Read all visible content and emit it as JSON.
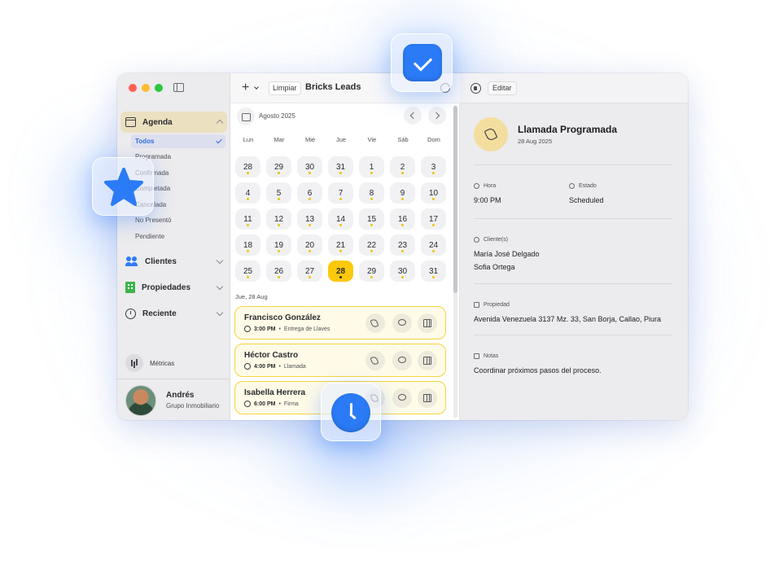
{
  "sidebar": {
    "agenda_label": "Agenda",
    "filters": [
      "Todos",
      "Programada",
      "Confirmada",
      "Completada",
      "Cancelada",
      "No Presentó",
      "Pendiente"
    ],
    "clientes_label": "Clientes",
    "propiedades_label": "Propiedades",
    "reciente_label": "Reciente",
    "metricas_label": "Métricas",
    "user": {
      "name": "Andrés",
      "org": "Grupo Inmobiliario"
    }
  },
  "toolbar": {
    "clear_label": "Limpiar",
    "title": "Bricks Leads"
  },
  "calendar": {
    "month_label": "Agosto 2025",
    "weekdays": [
      "Lun",
      "Mar",
      "Mié",
      "Jue",
      "Vie",
      "Sáb",
      "Dom"
    ],
    "days": [
      "28",
      "29",
      "30",
      "31",
      "1",
      "2",
      "3",
      "4",
      "5",
      "6",
      "7",
      "8",
      "9",
      "10",
      "11",
      "12",
      "13",
      "14",
      "15",
      "16",
      "17",
      "18",
      "19",
      "20",
      "21",
      "22",
      "23",
      "24",
      "25",
      "26",
      "27",
      "28",
      "29",
      "30",
      "31"
    ],
    "selected_index": 31,
    "date_header": "Jue, 28 Aug"
  },
  "appointments": [
    {
      "name": "Francisco González",
      "time": "3:00 PM",
      "type": "Entrega de Llaves"
    },
    {
      "name": "Héctor Castro",
      "time": "4:00 PM",
      "type": "Llamada"
    },
    {
      "name": "Isabella Herrera",
      "time": "6:00 PM",
      "type": "Firma"
    }
  ],
  "detail": {
    "edit_label": "Editar",
    "title": "Llamada Programada",
    "date": "28 Aug 2025",
    "hora_label": "Hora",
    "hora_value": "9:00 PM",
    "estado_label": "Estado",
    "estado_value": "Scheduled",
    "clientes_label": "Cliente(s)",
    "clientes": [
      "María José Delgado",
      "Sofia Ortega"
    ],
    "propiedad_label": "Propiedad",
    "propiedad_value": "Avenida Venezuela 3137 Mz. 33, San Borja, Callao, Piura",
    "notas_label": "Notas",
    "notas_value": "Coordinar próximos pasos del proceso."
  },
  "colors": {
    "accent": "#2b7bf7",
    "selected_day": "#fbc80b",
    "card_border": "#f5d43e"
  }
}
